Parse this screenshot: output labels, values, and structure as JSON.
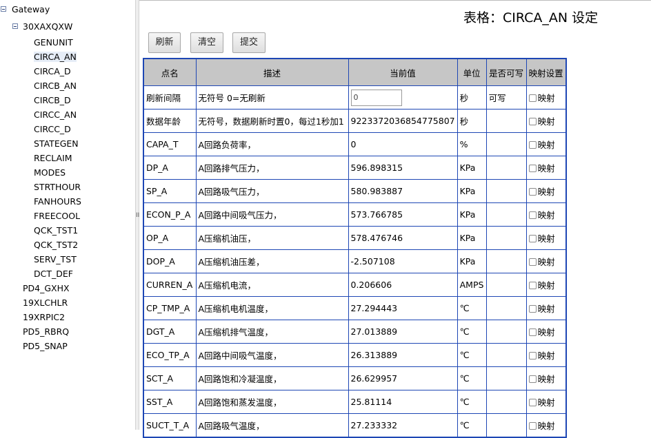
{
  "tree": {
    "root": "Gateway",
    "device": "30XAXQXW",
    "children": [
      "GENUNIT",
      "CIRCA_AN",
      "CIRCA_D",
      "CIRCB_AN",
      "CIRCB_D",
      "CIRCC_AN",
      "CIRCC_D",
      "STATEGEN",
      "RECLAIM",
      "MODES",
      "STRTHOUR",
      "FANHOURS",
      "FREECOOL",
      "QCK_TST1",
      "QCK_TST2",
      "SERV_TST",
      "DCT_DEF"
    ],
    "selected": "CIRCA_AN",
    "siblings": [
      "PD4_GXHX",
      "19XLCHLR",
      "19XRPIC2",
      "PD5_RBRQ",
      "PD5_SNAP"
    ]
  },
  "splitter_grip": "II",
  "page": {
    "title": "表格：CIRCA_AN 设定"
  },
  "toolbar": {
    "refresh": "刷新",
    "clear": "清空",
    "submit": "提交"
  },
  "table": {
    "headers": [
      "点名",
      "描述",
      "当前值",
      "单位",
      "是否可写",
      "映射设置"
    ],
    "map_label": "映射",
    "rows": [
      {
        "name": "刷新间隔",
        "desc": "无符号 0=无刷新",
        "value": "0",
        "unit": "秒",
        "writable": "可写",
        "editable": true
      },
      {
        "name": "数据年龄",
        "desc": "无符号，数据刷新时置0，每过1秒加1",
        "value": "9223372036854775807",
        "unit": "秒",
        "writable": ""
      },
      {
        "name": "CAPA_T",
        "desc": "A回路负荷率，",
        "value": "0",
        "unit": "%",
        "writable": ""
      },
      {
        "name": "DP_A",
        "desc": "A回路排气压力，",
        "value": "596.898315",
        "unit": "KPa",
        "writable": ""
      },
      {
        "name": "SP_A",
        "desc": "A回路吸气压力，",
        "value": "580.983887",
        "unit": "KPa",
        "writable": ""
      },
      {
        "name": "ECON_P_A",
        "desc": "A回路中间吸气压力，",
        "value": "573.766785",
        "unit": "KPa",
        "writable": ""
      },
      {
        "name": "OP_A",
        "desc": "A压缩机油压，",
        "value": "578.476746",
        "unit": "KPa",
        "writable": ""
      },
      {
        "name": "DOP_A",
        "desc": "A压缩机油压差，",
        "value": "-2.507108",
        "unit": "KPa",
        "writable": ""
      },
      {
        "name": "CURREN_A",
        "desc": "A压缩机电流，",
        "value": "0.206606",
        "unit": "AMPS",
        "writable": ""
      },
      {
        "name": "CP_TMP_A",
        "desc": "A压缩机电机温度，",
        "value": "27.294443",
        "unit": "℃",
        "writable": ""
      },
      {
        "name": "DGT_A",
        "desc": "A压缩机排气温度，",
        "value": "27.013889",
        "unit": "℃",
        "writable": ""
      },
      {
        "name": "ECO_TP_A",
        "desc": "A回路中间吸气温度，",
        "value": "26.313889",
        "unit": "℃",
        "writable": ""
      },
      {
        "name": "SCT_A",
        "desc": "A回路饱和冷凝温度，",
        "value": "26.629957",
        "unit": "℃",
        "writable": ""
      },
      {
        "name": "SST_A",
        "desc": "A回路饱和蒸发温度，",
        "value": "25.81114",
        "unit": "℃",
        "writable": ""
      },
      {
        "name": "SUCT_T_A",
        "desc": "A回路吸气温度，",
        "value": "27.233332",
        "unit": "℃",
        "writable": ""
      }
    ]
  }
}
